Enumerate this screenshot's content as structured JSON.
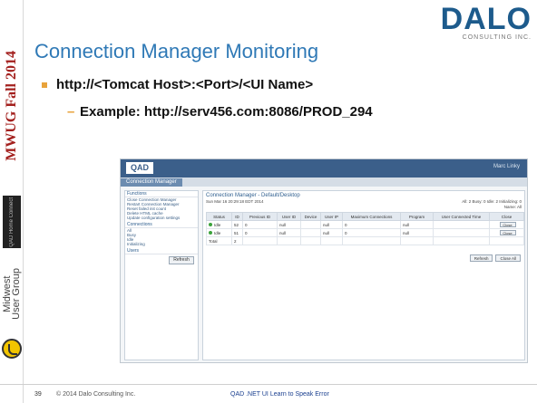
{
  "sidebar": {
    "event_label": "MWUG Fall 2014",
    "side_tab_label": "QAD Home Connect",
    "group_label": "Midwest\nUser Group"
  },
  "logo": {
    "name": "DALO",
    "tagline": "CONSULTING INC."
  },
  "slide": {
    "title": "Connection Manager Monitoring",
    "bullet_url": "http://<Tomcat Host>:<Port>/<UI Name>",
    "bullet_example": "Example: http://serv456.com:8086/PROD_294"
  },
  "screenshot": {
    "app_logo": "QAD",
    "user_label": "Marc Linky",
    "tab_label": "Connection Manager",
    "left_panel": {
      "functions_title": "Functions",
      "functions": [
        "Close Connection Manager",
        "Restart Connection Manager",
        "Reset failed init count",
        "Delete HTML cache",
        "Update configuration settings"
      ],
      "connections_title": "Connections",
      "connections": [
        "All",
        "Busy",
        "Idle",
        "Initializing"
      ],
      "users_title": "Users",
      "refresh_label": "Refresh"
    },
    "main": {
      "title": "Connection Manager - Default/Desktop",
      "timestamp": "Sun Mar 16 20:29:18 EDT 2014",
      "summary": "All: 2 Busy: 0 Idle: 2 Initializing: 0",
      "name": "Name: All",
      "columns": [
        "Status",
        "ID",
        "Previous ID",
        "User ID",
        "Device",
        "User IP",
        "Maximum Connections",
        "Program",
        "User Connected Time",
        "Close"
      ],
      "rows": [
        {
          "status": "Idle",
          "id": "52",
          "prev": "0",
          "user": "null",
          "device": "",
          "ip": "null",
          "max": "0",
          "program": "null",
          "time": "",
          "close": "Close"
        },
        {
          "status": "Idle",
          "id": "51",
          "prev": "0",
          "user": "null",
          "device": "",
          "ip": "null",
          "max": "0",
          "program": "null",
          "time": "",
          "close": "Close"
        }
      ],
      "total_label": "Total",
      "total_value": "2",
      "refresh_all": "Refresh",
      "close_all": "Close All"
    }
  },
  "footer": {
    "page_number": "39",
    "copyright": "© 2014 Dalo Consulting Inc.",
    "deck_title": "QAD .NET UI Learn to Speak Error"
  }
}
